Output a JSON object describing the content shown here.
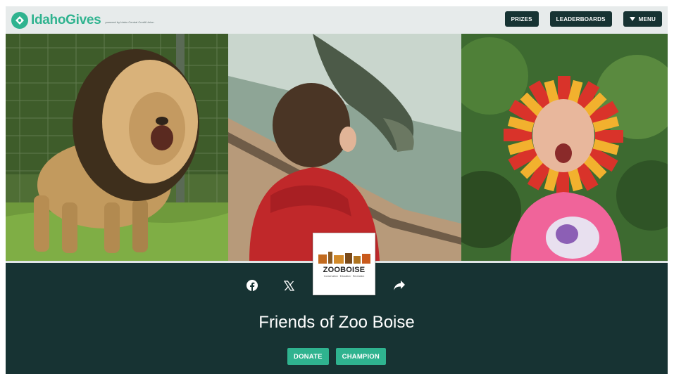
{
  "header": {
    "logo_text": "IdahoGives",
    "powered_by": "powered by Idaho Central Credit Union",
    "nav": {
      "prizes": "PRIZES",
      "leaderboards": "LEADERBOARDS",
      "menu": "MENU"
    }
  },
  "hero": {
    "images": [
      {
        "icon": "lion-photo"
      },
      {
        "icon": "child-alligator-photo"
      },
      {
        "icon": "girl-lion-mask-photo"
      }
    ]
  },
  "org": {
    "logo_name": "ZOOBOISE",
    "logo_tagline": "Conservation · Education · Recreation",
    "name": "Friends of Zoo Boise"
  },
  "share": {
    "facebook": "facebook-icon",
    "x": "x-icon",
    "share": "share-icon"
  },
  "actions": {
    "donate": "DONATE",
    "champion": "CHAMPION"
  },
  "colors": {
    "brand": "#2fb38f",
    "dark": "#173333",
    "header_bg": "#e7ebeb"
  }
}
